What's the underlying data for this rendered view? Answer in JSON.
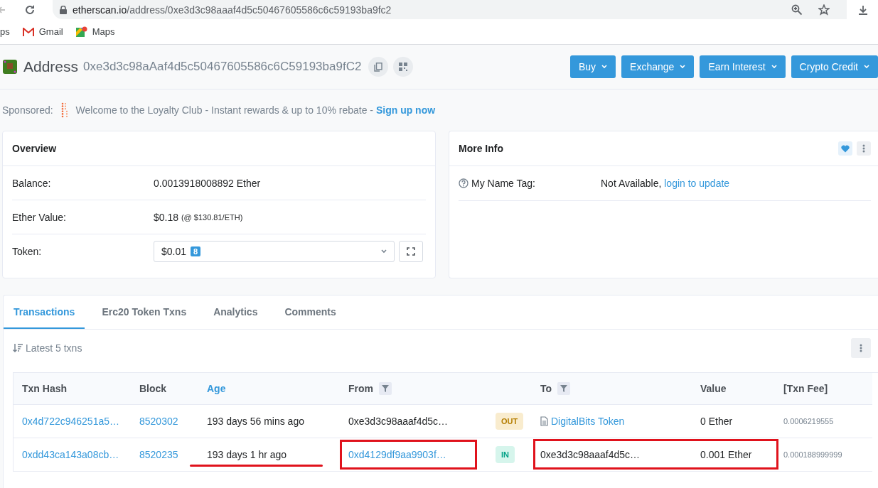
{
  "browser": {
    "url_host": "etherscan.io",
    "url_path": "/address/0xe3d3c98aaaf4d5c50467605586c6c59193ba9fc2",
    "bookmarks": [
      {
        "label": "ps",
        "kind": "apps"
      },
      {
        "label": "Gmail",
        "kind": "gmail"
      },
      {
        "label": "Maps",
        "kind": "maps"
      }
    ]
  },
  "header": {
    "title": "Address",
    "address": "0xe3d3c98aAaf4d5c50467605586c6C59193ba9fC2",
    "buttons": [
      "Buy",
      "Exchange",
      "Earn Interest",
      "Crypto Credit"
    ]
  },
  "sponsored": {
    "label": "Sponsored:",
    "text": "Welcome to the Loyalty Club - Instant rewards & up to 10% rebate - ",
    "link": "Sign up now"
  },
  "overview": {
    "title": "Overview",
    "balance": {
      "label": "Balance:",
      "value": "0.0013918008892 Ether"
    },
    "ether_value": {
      "label": "Ether Value:",
      "value": "$0.18",
      "note": "(@ $130.81/ETH)"
    },
    "token": {
      "label": "Token:",
      "value": "$0.01",
      "count": "8"
    }
  },
  "more_info": {
    "title": "More Info",
    "name_tag": {
      "label": "My Name Tag:",
      "value": "Not Available, ",
      "link": "login to update"
    }
  },
  "tabs": [
    {
      "label": "Transactions",
      "selected": true
    },
    {
      "label": "Erc20 Token Txns",
      "selected": false
    },
    {
      "label": "Analytics",
      "selected": false
    },
    {
      "label": "Comments",
      "selected": false
    }
  ],
  "latest": "Latest 5 txns",
  "columns": [
    {
      "label": "Txn Hash",
      "filter": false,
      "active": false
    },
    {
      "label": "Block",
      "filter": false,
      "active": false
    },
    {
      "label": "Age",
      "filter": false,
      "active": true
    },
    {
      "label": "From",
      "filter": true,
      "active": false
    },
    {
      "label": "To",
      "filter": true,
      "active": false
    },
    {
      "label": "Value",
      "filter": false,
      "active": false
    },
    {
      "label": "[Txn Fee]",
      "filter": false,
      "active": false
    }
  ],
  "rows": [
    {
      "hash": "0x4d722c946251a5…",
      "block": "8520302",
      "age": "193 days 56 mins ago",
      "from": "0xe3d3c98aaaf4d5c…",
      "from_link": false,
      "direction": "OUT",
      "to": "DigitalBits Token",
      "to_link": true,
      "value": "0 Ether",
      "fee": "0.0006219555",
      "underline_age": false,
      "box_from": false,
      "box_to_value": false
    },
    {
      "hash": "0xdd43ca143a08cb…",
      "block": "8520235",
      "age": "193 days 1 hr ago",
      "from": "0xd4129df9aa9903f…",
      "from_link": true,
      "direction": "IN",
      "to": "0xe3d3c98aaaf4d5c…",
      "to_link": false,
      "value": "0.001 Ether",
      "fee": "0.000188999999",
      "underline_age": true,
      "box_from": true,
      "box_to_value": true
    }
  ]
}
